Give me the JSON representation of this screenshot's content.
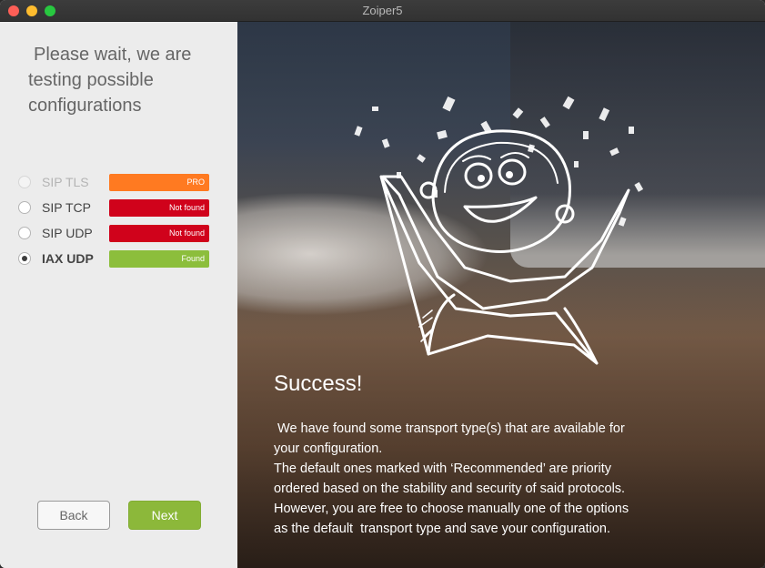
{
  "window": {
    "title": "Zoiper5"
  },
  "heading_lines": [
    "Please wait, we are",
    "testing possible",
    "configurations"
  ],
  "options": [
    {
      "label": "SIP TLS",
      "badge": "PRO",
      "badge_color": "#ff7a21",
      "state": "disabled"
    },
    {
      "label": "SIP TCP",
      "badge": "Not found",
      "badge_color": "#d0021b",
      "state": "unchecked"
    },
    {
      "label": "SIP UDP",
      "badge": "Not found",
      "badge_color": "#d0021b",
      "state": "unchecked"
    },
    {
      "label": "IAX UDP",
      "badge": "Found",
      "badge_color": "#8cbe3c",
      "state": "checked"
    }
  ],
  "buttons": {
    "back": "Back",
    "next": "Next"
  },
  "panel": {
    "success_title": "Success!",
    "message_lines": [
      " We have found some transport type(s) that are available for",
      "your configuration.",
      "The default ones marked with ‘Recommended’ are priority",
      "ordered based on the stability and security of said protocols.",
      "However, you are free to choose manually one of the options",
      "as the default  transport type and save your configuration."
    ]
  },
  "colors": {
    "accent_green": "#8cb83a",
    "pro_orange": "#ff7a21",
    "not_found_red": "#d0021b"
  }
}
